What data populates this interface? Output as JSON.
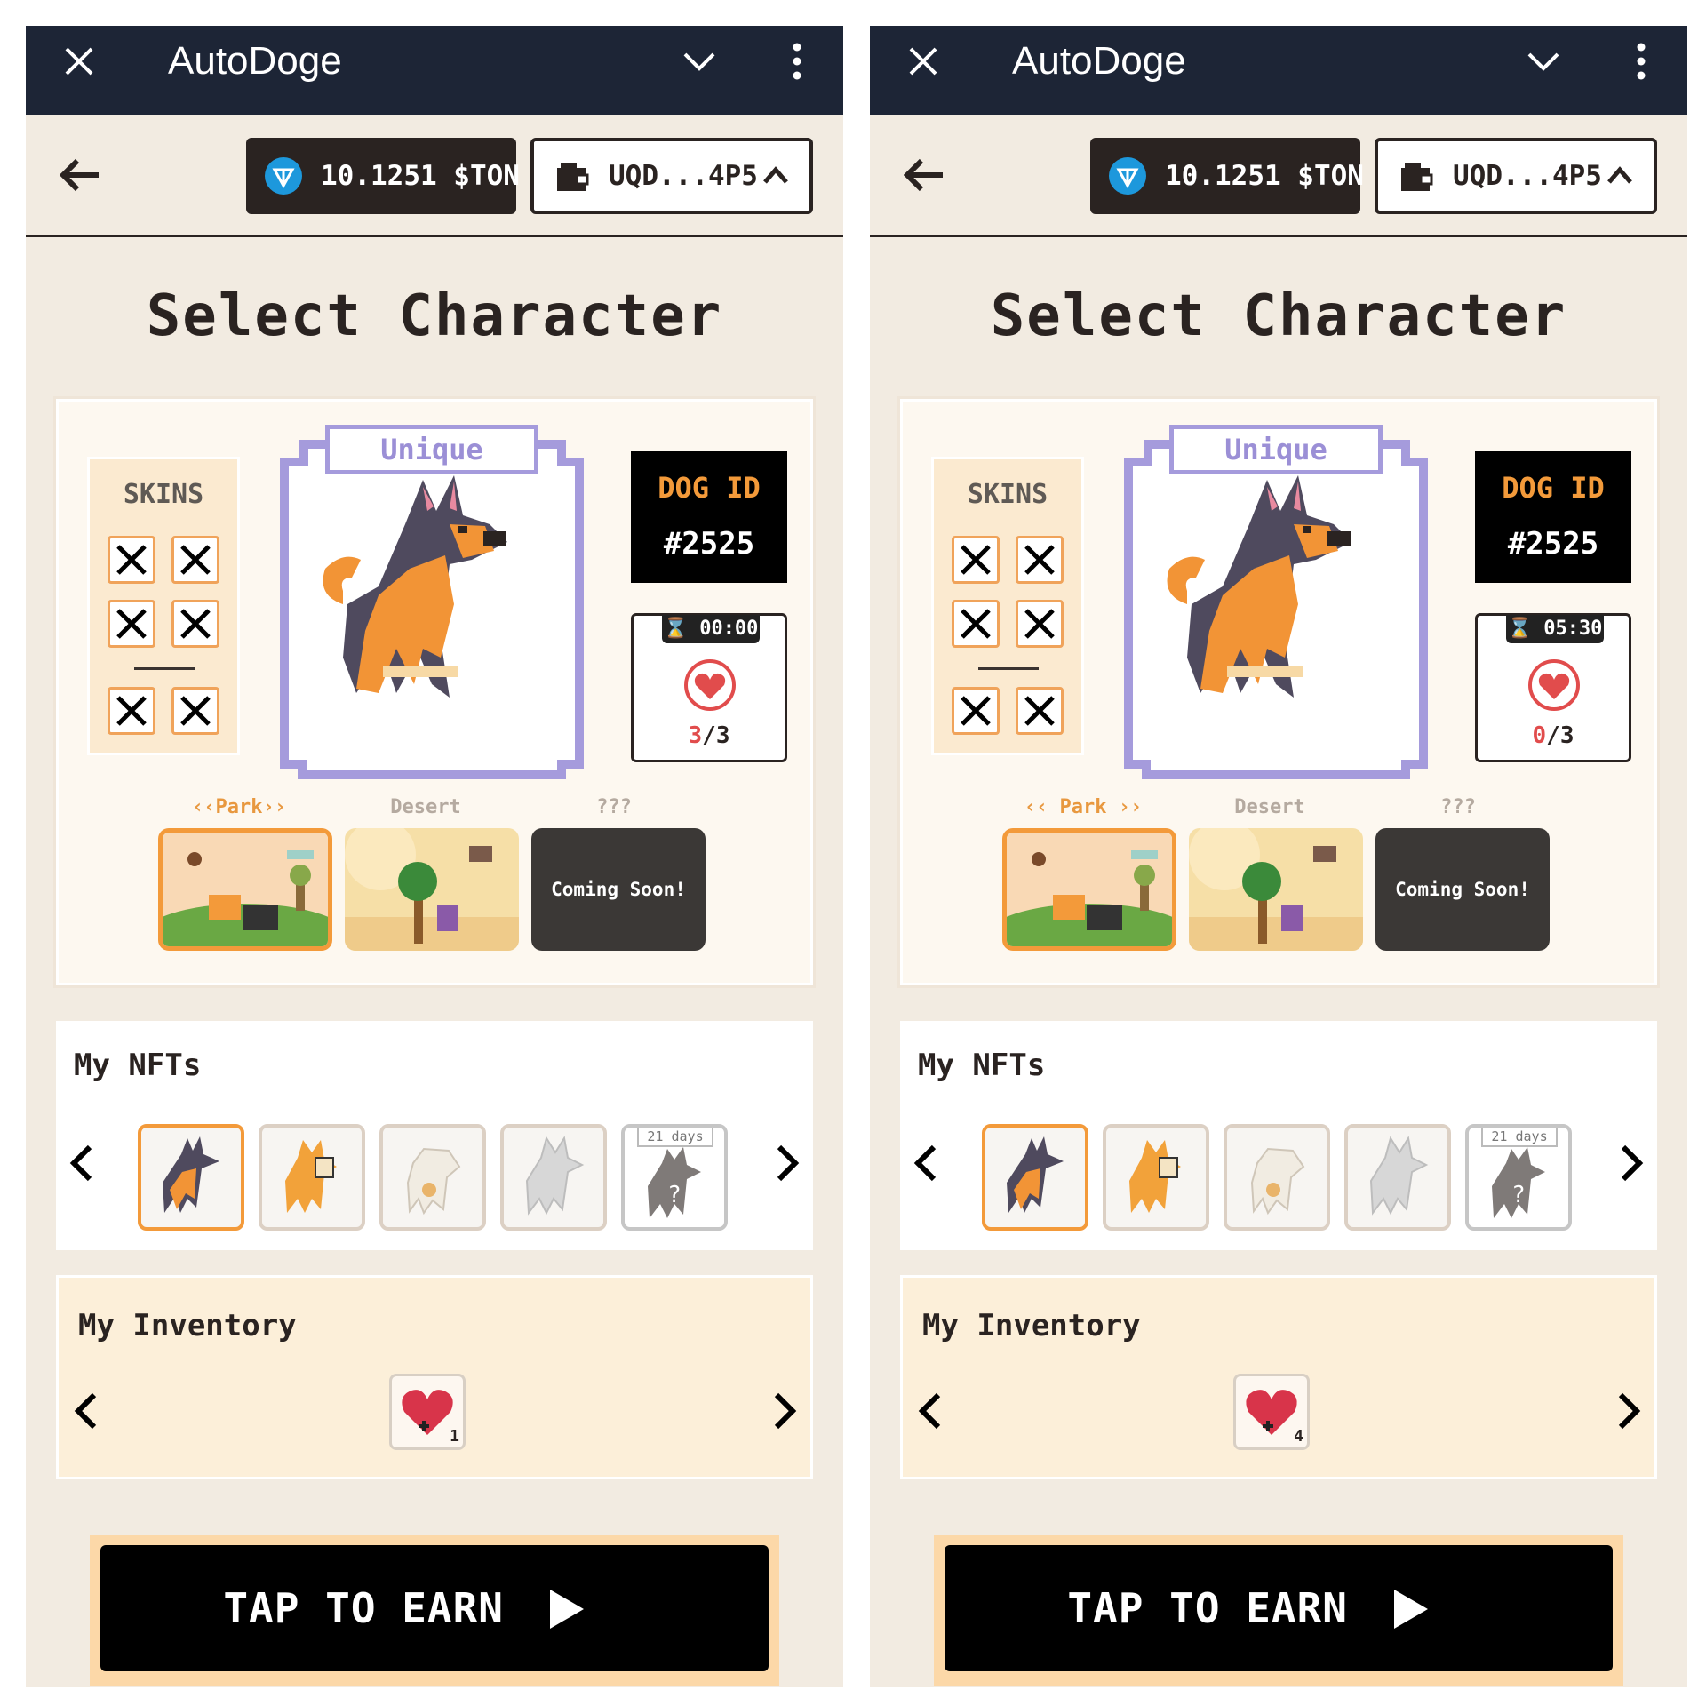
{
  "screens": [
    {
      "app_title": "AutoDoge",
      "balance": "10.1251 $TON",
      "wallet_address": "UQD...4P5",
      "page_title": "Select Character",
      "skins_label": "SKINS",
      "rarity": "Unique",
      "dog_id_label": "DOG ID",
      "dog_id": "#2525",
      "energy_timer": "⌛ 00:00",
      "energy_current": "3",
      "energy_max": "/3",
      "locations": [
        {
          "label": "‹‹Park››",
          "active": true
        },
        {
          "label": "Desert",
          "active": false
        },
        {
          "label": "???",
          "active": false,
          "text": "Coming Soon!"
        }
      ],
      "nfts_title": "My NFTs",
      "nft_locked_days": "21 days",
      "inventory_title": "My Inventory",
      "inventory_item_qty": "1",
      "cta_label": "TAP TO EARN"
    },
    {
      "app_title": "AutoDoge",
      "balance": "10.1251 $TON",
      "wallet_address": "UQD...4P5",
      "page_title": "Select Character",
      "skins_label": "SKINS",
      "rarity": "Unique",
      "dog_id_label": "DOG ID",
      "dog_id": "#2525",
      "energy_timer": "⌛ 05:30",
      "energy_current": "0",
      "energy_max": "/3",
      "locations": [
        {
          "label": "‹‹ Park ››",
          "active": true
        },
        {
          "label": "Desert",
          "active": false
        },
        {
          "label": "???",
          "active": false,
          "text": "Coming Soon!"
        }
      ],
      "nfts_title": "My NFTs",
      "nft_locked_days": "21 days",
      "inventory_title": "My Inventory",
      "inventory_item_qty": "4",
      "cta_label": "TAP TO EARN"
    }
  ],
  "colors": {
    "topbar": "#1d2536",
    "page_bg": "#f2ebe1",
    "accent_orange": "#f39a3a",
    "rarity_purple": "#a59bdc",
    "heart_red": "#e14c4c",
    "ton_blue": "#1d98dc"
  },
  "icons": {
    "close": "close-icon",
    "collapse": "chevron-down-icon",
    "menu": "kebab-menu-icon",
    "back": "arrow-left-icon",
    "ton": "ton-diamond-icon",
    "wallet": "wallet-icon",
    "expand": "chevron-up-icon",
    "skin_empty": "x-mark-icon",
    "heart": "heart-icon",
    "prev": "chevron-left-icon",
    "next": "chevron-right-icon",
    "play": "play-icon"
  }
}
